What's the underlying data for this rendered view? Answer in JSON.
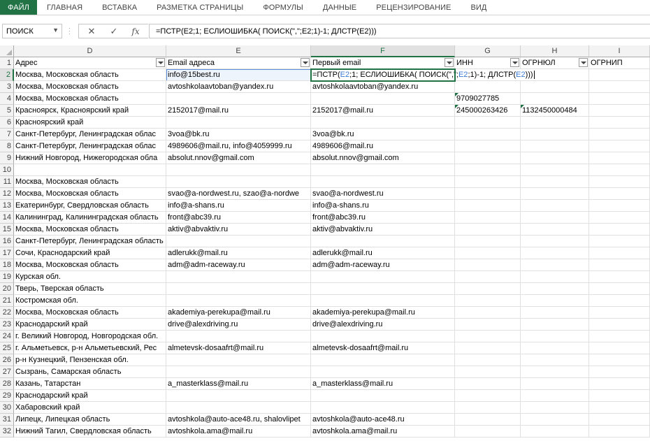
{
  "ribbon_tabs": [
    "ФАЙЛ",
    "ГЛАВНАЯ",
    "ВСТАВКА",
    "РАЗМЕТКА СТРАНИЦЫ",
    "ФОРМУЛЫ",
    "ДАННЫЕ",
    "РЕЦЕНЗИРОВАНИЕ",
    "ВИД"
  ],
  "name_box": "ПОИСК",
  "formula_bar": {
    "cancel_icon": "close-icon",
    "enter_icon": "check-icon",
    "fx_label": "fx",
    "text": "=ПСТР(E2;1; ЕСЛИОШИБКА( ПОИСК(\",\";E2;1)-1; ДЛСТР(E2)))"
  },
  "columns": [
    "D",
    "E",
    "F",
    "G",
    "H",
    "I"
  ],
  "headers": {
    "D": "Адрес",
    "E": "Email адреса",
    "F": "Первый email",
    "G": "ИНН",
    "H": "ОГРНЮЛ",
    "I": "ОГРНИП"
  },
  "edit_formula": {
    "p1": "=ПСТР(",
    "r1": "E2",
    "p2": ";1; ЕСЛИОШИБКА( ПОИСК(\",\";",
    "r2": "E2",
    "p3": ";1)-1; ДЛСТР(",
    "r3": "E2",
    "p4": ")))"
  },
  "rows": [
    {
      "n": "1"
    },
    {
      "n": "2",
      "D": "Москва, Московская область",
      "E": "info@15best.ru"
    },
    {
      "n": "3",
      "D": "Москва, Московская область",
      "E": "avtoshkolaavtoban@yandex.ru",
      "F": "avtoshkolaavtoban@yandex.ru"
    },
    {
      "n": "4",
      "D": "Москва, Московская область",
      "G": "9709027785"
    },
    {
      "n": "5",
      "D": "Красноярск, Красноярский край",
      "E": "2152017@mail.ru",
      "F": "2152017@mail.ru",
      "G": "245000263426",
      "H": "1132450000484"
    },
    {
      "n": "6",
      "D": "Красноярский край"
    },
    {
      "n": "7",
      "D": "Санкт-Петербург, Ленинградская облас",
      "E": "3voa@bk.ru",
      "F": "3voa@bk.ru"
    },
    {
      "n": "8",
      "D": "Санкт-Петербург, Ленинградская облас",
      "E": "4989606@mail.ru, info@4059999.ru",
      "F": "4989606@mail.ru"
    },
    {
      "n": "9",
      "D": "Нижний Новгород, Нижегородская обла",
      "E": "absolut.nnov@gmail.com",
      "F": "absolut.nnov@gmail.com"
    },
    {
      "n": "10"
    },
    {
      "n": "11",
      "D": "Москва, Московская область"
    },
    {
      "n": "12",
      "D": "Москва, Московская область",
      "E": "svao@a-nordwest.ru, szao@a-nordwe",
      "F": "svao@a-nordwest.ru"
    },
    {
      "n": "13",
      "D": "Екатеринбург, Свердловская область",
      "E": "info@a-shans.ru",
      "F": "info@a-shans.ru"
    },
    {
      "n": "14",
      "D": "Калининград, Калининградская область",
      "E": "front@abc39.ru",
      "F": "front@abc39.ru"
    },
    {
      "n": "15",
      "D": "Москва, Московская область",
      "E": "aktiv@abvaktiv.ru",
      "F": "aktiv@abvaktiv.ru"
    },
    {
      "n": "16",
      "D": "Санкт-Петербург, Ленинградская область"
    },
    {
      "n": "17",
      "D": "Сочи, Краснодарский край",
      "E": "adlerukk@mail.ru",
      "F": "adlerukk@mail.ru"
    },
    {
      "n": "18",
      "D": "Москва, Московская область",
      "E": "adm@adm-raceway.ru",
      "F": "adm@adm-raceway.ru"
    },
    {
      "n": "19",
      "D": "Курская обл."
    },
    {
      "n": "20",
      "D": "Тверь, Тверская область"
    },
    {
      "n": "21",
      "D": "Костромская обл."
    },
    {
      "n": "22",
      "D": "Москва, Московская область",
      "E": "akademiya-perekupa@mail.ru",
      "F": "akademiya-perekupa@mail.ru"
    },
    {
      "n": "23",
      "D": "Краснодарский край",
      "E": "drive@alexdriving.ru",
      "F": "drive@alexdriving.ru"
    },
    {
      "n": "24",
      "D": "г. Великий Новгород, Новгородская обл."
    },
    {
      "n": "25",
      "D": "г. Альметьевск, р-н Альметьевский, Рес",
      "E": "almetevsk-dosaafrt@mail.ru",
      "F": "almetevsk-dosaafrt@mail.ru"
    },
    {
      "n": "26",
      "D": "р-н Кузнецкий, Пензенская обл."
    },
    {
      "n": "27",
      "D": "Сызрань, Самарская область"
    },
    {
      "n": "28",
      "D": "Казань, Татарстан",
      "E": "a_masterklass@mail.ru",
      "F": "a_masterklass@mail.ru"
    },
    {
      "n": "29",
      "D": "Краснодарский край"
    },
    {
      "n": "30",
      "D": "Хабаровский край"
    },
    {
      "n": "31",
      "D": "Липецк, Липецкая область",
      "E": "avtoshkola@auto-ace48.ru, shalovlipet",
      "F": "avtoshkola@auto-ace48.ru"
    },
    {
      "n": "32",
      "D": "Нижний Тагил, Свердловская область",
      "E": "avtoshkola.ama@mail.ru",
      "F": "avtoshkola.ama@mail.ru"
    }
  ]
}
